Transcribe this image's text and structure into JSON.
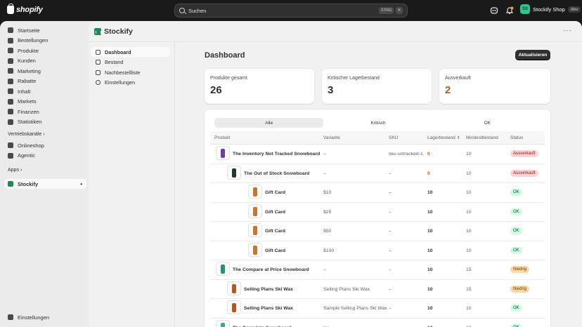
{
  "topbar": {
    "brand": "shopify",
    "search_placeholder": "Suchen",
    "kbd1": "STRG",
    "kbd2": "K",
    "store_name": "Stockify Shop",
    "store_initials": "SS",
    "env_tag": "dev",
    "notification_count": "1"
  },
  "nav": {
    "items": [
      {
        "label": "Startseite",
        "icon": "home-icon"
      },
      {
        "label": "Bestellungen",
        "icon": "inbox-icon"
      },
      {
        "label": "Produkte",
        "icon": "tag-icon"
      },
      {
        "label": "Kunden",
        "icon": "person-icon"
      },
      {
        "label": "Marketing",
        "icon": "target-icon"
      },
      {
        "label": "Rabatte",
        "icon": "discount-icon"
      },
      {
        "label": "Inhalt",
        "icon": "content-icon"
      },
      {
        "label": "Markets",
        "icon": "globe-icon"
      },
      {
        "label": "Finanzen",
        "icon": "bank-icon"
      },
      {
        "label": "Statistiken",
        "icon": "chart-icon"
      }
    ],
    "sales_channels_label": "Vertriebskanäle",
    "channels": [
      {
        "label": "Onlineshop",
        "icon": "store-icon"
      },
      {
        "label": "Agentic",
        "icon": "agent-icon"
      }
    ],
    "apps_label": "Apps",
    "app_item": "Stockify",
    "settings_label": "Einstellungen"
  },
  "app": {
    "title": "Stockify",
    "subnav": [
      {
        "label": "Dashboard",
        "active": true
      },
      {
        "label": "Bestand",
        "active": false
      },
      {
        "label": "Nachbestellliste",
        "active": false
      },
      {
        "label": "Einstellungen",
        "active": false
      }
    ]
  },
  "dashboard": {
    "title": "Dashboard",
    "refresh_label": "Aktualisieren",
    "stats": [
      {
        "label": "Produkte gesamt",
        "value": "26"
      },
      {
        "label": "Kritischer Lagerbestand",
        "value": "3"
      },
      {
        "label": "Ausverkauft",
        "value": "2"
      }
    ],
    "tabs": [
      "Alle",
      "Kritisch",
      "OK"
    ],
    "columns": [
      "Produkt",
      "Variante",
      "SKU",
      "Lagerbestand",
      "Mindestbestand",
      "Status"
    ],
    "rows": [
      {
        "product": "The Inventory Not Tracked Snowboard",
        "variant": "–",
        "sku": "sku-untracked-1",
        "stock": "0",
        "min": "10",
        "status": "Ausverkauft",
        "level": "critical",
        "indent": 0
      },
      {
        "product": "The Out of Stock Snowboard",
        "variant": "–",
        "sku": "–",
        "stock": "0",
        "min": "10",
        "status": "Ausverkauft",
        "level": "critical",
        "indent": 1
      },
      {
        "product": "Gift Card",
        "variant": "$10",
        "sku": "–",
        "stock": "10",
        "min": "10",
        "status": "OK",
        "level": "ok",
        "indent": 2
      },
      {
        "product": "Gift Card",
        "variant": "$25",
        "sku": "–",
        "stock": "10",
        "min": "10",
        "status": "OK",
        "level": "ok",
        "indent": 2
      },
      {
        "product": "Gift Card",
        "variant": "$50",
        "sku": "–",
        "stock": "10",
        "min": "10",
        "status": "OK",
        "level": "ok",
        "indent": 2
      },
      {
        "product": "Gift Card",
        "variant": "$100",
        "sku": "–",
        "stock": "10",
        "min": "10",
        "status": "OK",
        "level": "ok",
        "indent": 2
      },
      {
        "product": "The Compare at Price Snowboard",
        "variant": "–",
        "sku": "–",
        "stock": "10",
        "min": "15",
        "status": "Niedrig",
        "level": "low",
        "indent": 0
      },
      {
        "product": "Selling Plans Ski Wax",
        "variant": "Selling Plans Ski Wax",
        "sku": "–",
        "stock": "10",
        "min": "15",
        "status": "Niedrig",
        "level": "low",
        "indent": 1
      },
      {
        "product": "Selling Plans Ski Wax",
        "variant": "Sample Selling Plans Ski Wax",
        "sku": "–",
        "stock": "10",
        "min": "10",
        "status": "OK",
        "level": "ok",
        "indent": 1
      },
      {
        "product": "The Complete Snowboard",
        "variant": "Ice",
        "sku": "–",
        "stock": "10",
        "min": "10",
        "status": "OK",
        "level": "ok",
        "indent": 0
      }
    ]
  },
  "colors": {
    "accent_green": "#2ec48b",
    "critical_bg": "#fed1d7",
    "ok_bg": "#cdfee1",
    "low_bg": "#ffd6a4",
    "warn_text": "#b35c1e"
  }
}
